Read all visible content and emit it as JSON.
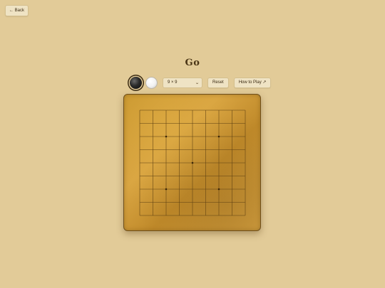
{
  "header": {
    "back_label": "← Back",
    "title": "Go"
  },
  "controls": {
    "stone_black": "black-stone",
    "stone_white": "white-stone",
    "board_size_selected": "9 × 9",
    "reset_label": "Reset",
    "how_to_play_label": "How to Play ↗"
  },
  "board": {
    "size": 9,
    "star_points": [
      [
        2,
        2
      ],
      [
        6,
        2
      ],
      [
        4,
        4
      ],
      [
        2,
        6
      ],
      [
        6,
        6
      ]
    ],
    "stones": []
  },
  "colors": {
    "background": "#e2cb98",
    "board_wood": "#d09a36",
    "grid_line": "#5a3e12"
  }
}
